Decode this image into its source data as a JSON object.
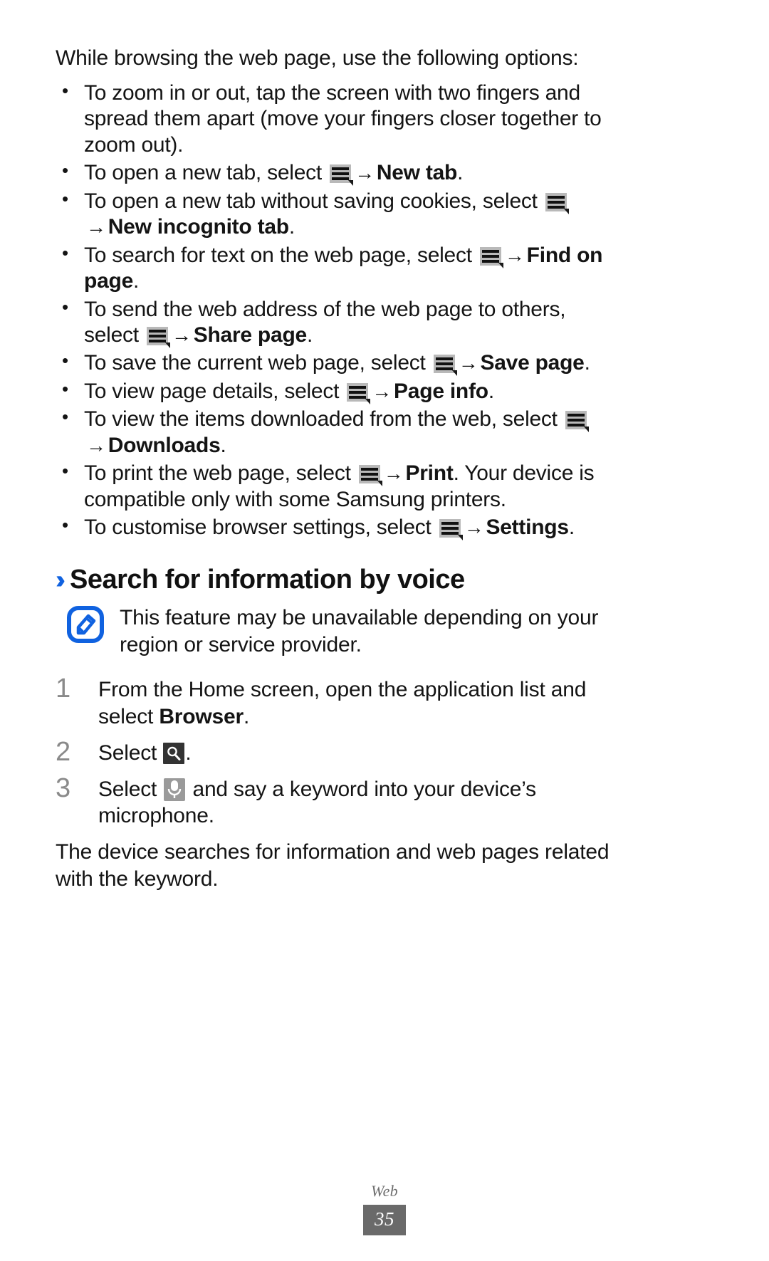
{
  "document": {
    "intro": "While browsing the web page, use the following options:",
    "footer_label": "Web",
    "page_number": "35"
  },
  "bullets": [
    {
      "id": "zoom",
      "parts": [
        {
          "type": "text",
          "value": "To zoom in or out, tap the screen with two fingers and spread them apart (move your fingers closer together to zoom out)."
        }
      ]
    },
    {
      "id": "new-tab",
      "parts": [
        {
          "type": "text",
          "value": "To open a new tab, select "
        },
        {
          "type": "icon",
          "value": "menu-icon"
        },
        {
          "type": "arrow",
          "value": "→"
        },
        {
          "type": "bold",
          "value": "New tab"
        },
        {
          "type": "text",
          "value": "."
        }
      ]
    },
    {
      "id": "new-incognito-tab",
      "parts": [
        {
          "type": "text",
          "value": "To open a new tab without saving cookies, select "
        },
        {
          "type": "icon",
          "value": "menu-icon"
        },
        {
          "type": "arrow",
          "value": "→"
        },
        {
          "type": "bold",
          "value": "New incognito tab"
        },
        {
          "type": "text",
          "value": "."
        }
      ]
    },
    {
      "id": "find-on-page",
      "parts": [
        {
          "type": "text",
          "value": "To search for text on the web page, select "
        },
        {
          "type": "icon",
          "value": "menu-icon"
        },
        {
          "type": "arrow",
          "value": "→"
        },
        {
          "type": "bold",
          "value": "Find on page"
        },
        {
          "type": "text",
          "value": "."
        }
      ]
    },
    {
      "id": "share-page",
      "parts": [
        {
          "type": "text",
          "value": "To send the web address of the web page to others, select "
        },
        {
          "type": "icon",
          "value": "menu-icon"
        },
        {
          "type": "arrow",
          "value": "→"
        },
        {
          "type": "bold",
          "value": "Share page"
        },
        {
          "type": "text",
          "value": "."
        }
      ]
    },
    {
      "id": "save-page",
      "parts": [
        {
          "type": "text",
          "value": "To save the current web page, select "
        },
        {
          "type": "icon",
          "value": "menu-icon"
        },
        {
          "type": "arrow",
          "value": "→"
        },
        {
          "type": "bold",
          "value": "Save page"
        },
        {
          "type": "text",
          "value": "."
        }
      ]
    },
    {
      "id": "page-info",
      "parts": [
        {
          "type": "text",
          "value": "To view page details, select "
        },
        {
          "type": "icon",
          "value": "menu-icon"
        },
        {
          "type": "arrow",
          "value": "→"
        },
        {
          "type": "bold",
          "value": "Page info"
        },
        {
          "type": "text",
          "value": "."
        }
      ]
    },
    {
      "id": "downloads",
      "parts": [
        {
          "type": "text",
          "value": "To view the items downloaded from the web, select "
        },
        {
          "type": "icon",
          "value": "menu-icon"
        },
        {
          "type": "arrow",
          "value": "→"
        },
        {
          "type": "bold",
          "value": "Downloads"
        },
        {
          "type": "text",
          "value": "."
        }
      ]
    },
    {
      "id": "print",
      "parts": [
        {
          "type": "text",
          "value": "To print the web page, select "
        },
        {
          "type": "icon",
          "value": "menu-icon"
        },
        {
          "type": "arrow",
          "value": "→"
        },
        {
          "type": "bold",
          "value": "Print"
        },
        {
          "type": "text",
          "value": ". Your device is compatible only with some Samsung printers."
        }
      ]
    },
    {
      "id": "settings",
      "parts": [
        {
          "type": "text",
          "value": "To customise browser settings, select "
        },
        {
          "type": "icon",
          "value": "menu-icon"
        },
        {
          "type": "arrow",
          "value": "→"
        },
        {
          "type": "bold",
          "value": "Settings"
        },
        {
          "type": "text",
          "value": "."
        }
      ]
    }
  ],
  "section": {
    "chevron": "››",
    "title": "Search for information by voice",
    "accent_color": "#1062e0"
  },
  "note": {
    "icon": "note-pencil-icon",
    "text": "This feature may be unavailable depending on your region or service provider."
  },
  "steps": [
    {
      "number": "1",
      "parts": [
        {
          "type": "text",
          "value": "From the Home screen, open the application list and select "
        },
        {
          "type": "bold",
          "value": "Browser"
        },
        {
          "type": "text",
          "value": "."
        }
      ]
    },
    {
      "number": "2",
      "parts": [
        {
          "type": "text",
          "value": "Select "
        },
        {
          "type": "icon",
          "value": "search-icon"
        },
        {
          "type": "text",
          "value": "."
        }
      ]
    },
    {
      "number": "3",
      "parts": [
        {
          "type": "text",
          "value": "Select "
        },
        {
          "type": "icon",
          "value": "microphone-icon"
        },
        {
          "type": "text",
          "value": " and say a keyword into your device’s microphone."
        }
      ]
    }
  ],
  "step_extra": "The device searches for information and web pages related with the keyword."
}
